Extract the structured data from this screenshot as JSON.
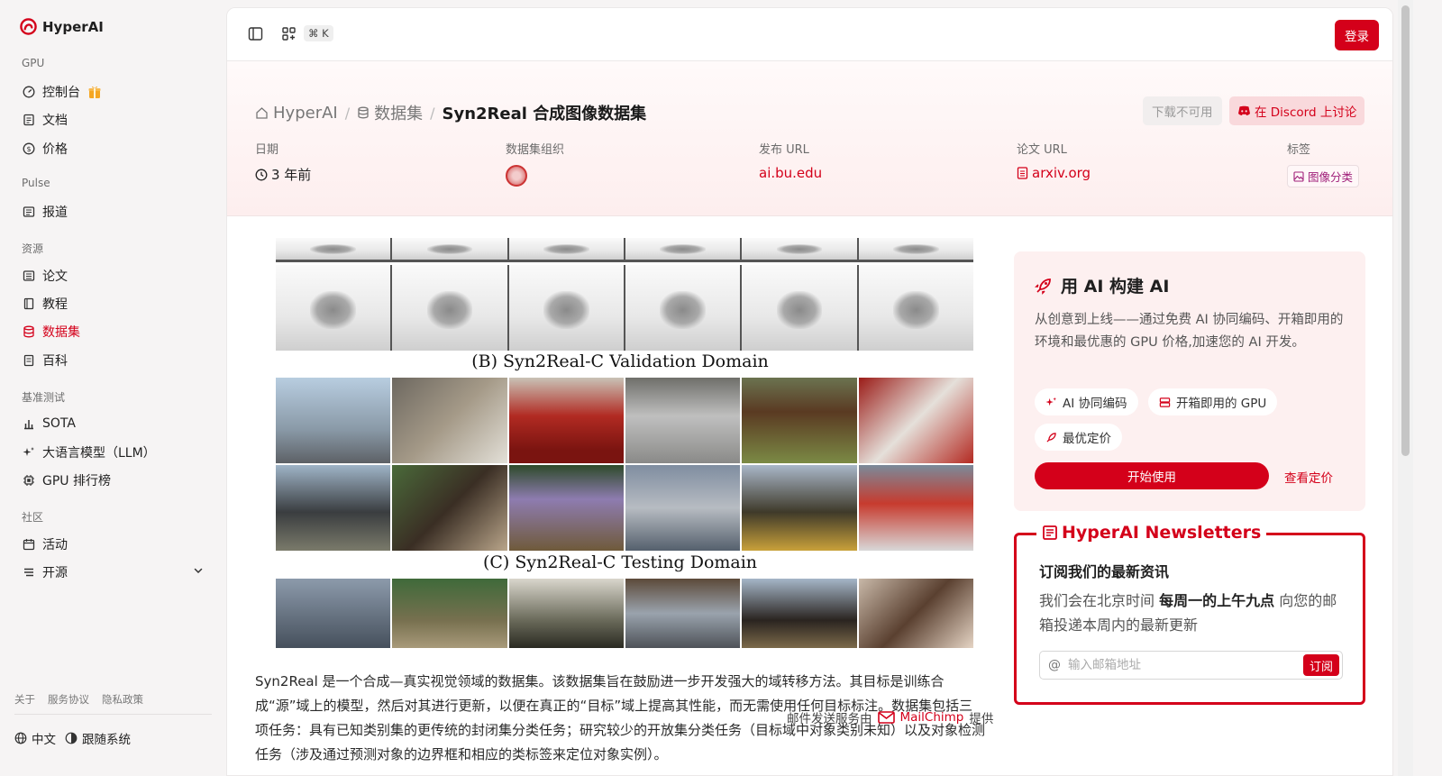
{
  "brand": {
    "name": "HyperAI"
  },
  "sidebar": {
    "groups": {
      "gpu": "GPU",
      "pulse": "Pulse",
      "resources": "资源",
      "benchmark": "基准测试",
      "community": "社区"
    },
    "items": {
      "console": "控制台",
      "docs": "文档",
      "pricing": "价格",
      "news": "报道",
      "papers": "论文",
      "tutorials": "教程",
      "datasets": "数据集",
      "wiki": "百科",
      "sota": "SOTA",
      "llm": "大语言模型（LLM）",
      "gpu_rank": "GPU 排行榜",
      "events": "活动",
      "opensource": "开源"
    },
    "footer_links": [
      "关于",
      "服务协议",
      "隐私政策"
    ],
    "language": "中文",
    "theme": "跟随系统"
  },
  "topbar": {
    "shortcut": "⌘ K",
    "login": "登录"
  },
  "breadcrumb": {
    "home": "HyperAI",
    "section": "数据集",
    "current": "Syn2Real 合成图像数据集"
  },
  "actions": {
    "download": "下载不可用",
    "discord": "在 Discord 上讨论"
  },
  "meta": {
    "date_label": "日期",
    "date_value": "3 年前",
    "org_label": "数据集组织",
    "publish_label": "发布 URL",
    "publish_value": "ai.bu.edu",
    "paper_label": "论文 URL",
    "paper_value": "arxiv.org",
    "tags_label": "标签",
    "tag_value": "图像分类"
  },
  "figure": {
    "label_b": "(B) Syn2Real-C Validation Domain",
    "label_c": "(C) Syn2Real-C Testing Domain"
  },
  "description": "Syn2Real 是一个合成—真实视觉领域的数据集。该数据集旨在鼓励进一步开发强大的域转移方法。其目标是训练合成“源”域上的模型，然后对其进行更新，以便在真正的“目标”域上提高其性能，而无需使用任何目标标注。数据集包括三项任务：具有已知类别集的更传统的封闭集分类任务；研究较少的开放集分类任务（目标域中对象类别未知）以及对象检测任务（涉及通过预测对象的边界框和相应的类标签来定位对象实例）。",
  "ai_card": {
    "title": "用 AI 构建 AI",
    "body": "从创意到上线——通过免费 AI 协同编码、开箱即用的环境和最优惠的 GPU 价格,加速您的 AI 开发。",
    "pill1": "AI 协同编码",
    "pill2": "开箱即用的 GPU",
    "pill3": "最优定价",
    "start": "开始使用",
    "pricing": "查看定价"
  },
  "newsletter": {
    "title": "HyperAI Newsletters",
    "subtitle": "订阅我们的最新资讯",
    "text_pre": "我们会在北京时间",
    "text_bold": "每周一的上午九点",
    "text_post": "向您的邮箱投递本周内的最新更新",
    "placeholder": "输入邮箱地址",
    "subscribe": "订阅",
    "footer_pre": "邮件发送服务由",
    "footer_brand": "MailChimp",
    "footer_post": "提供"
  },
  "colors": {
    "accent": "#d4001a",
    "accent_soft": "#f9d9dc"
  }
}
